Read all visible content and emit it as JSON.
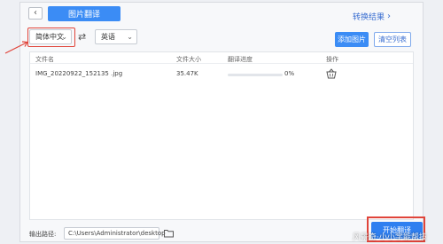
{
  "header": {
    "back_icon": "chevron-left-icon",
    "title": "图片翻译",
    "results_link": "转换结果"
  },
  "languages": {
    "source": "简体中文",
    "target": "英语",
    "swap_icon": "swap-icon"
  },
  "actions": {
    "add_image": "添加图片",
    "clear_list": "清空列表"
  },
  "table": {
    "columns": [
      "文件名",
      "文件大小",
      "翻译进度",
      "操作"
    ],
    "rows": [
      {
        "filename": "IMG_20220922_152135 .jpg",
        "size": "35.47K",
        "progress": 0,
        "progress_text": "0%",
        "action_icon": "basket-icon"
      }
    ]
  },
  "footer": {
    "output_label": "输出路径:",
    "output_path": "C:\\Users\\Administrator\\desktop",
    "folder_icon": "folder-icon",
    "start_button": "开始翻译"
  },
  "watermark": "风景奇·小小学能帮技",
  "colors": {
    "accent": "#3b8cf5",
    "highlight": "#e0443a"
  }
}
